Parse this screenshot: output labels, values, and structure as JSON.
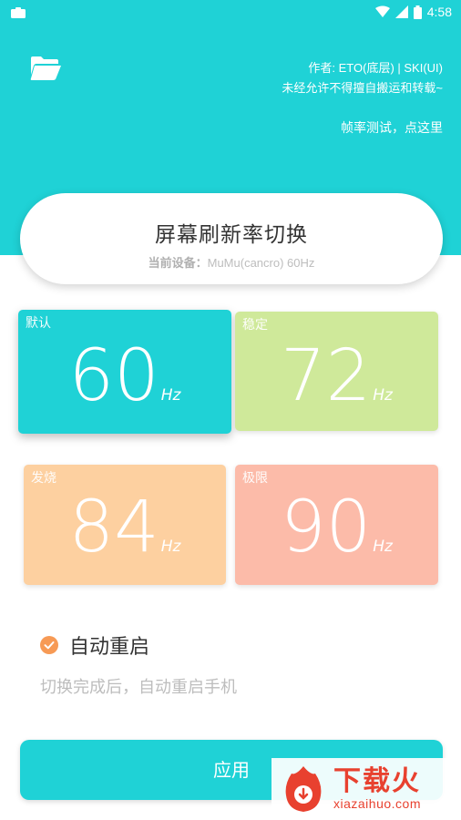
{
  "status_bar": {
    "time": "4:58"
  },
  "header": {
    "author": "作者: ETO(底层) | SKI(UI)",
    "notice": "未经允许不得擅自搬运和转载~",
    "fps_link": "帧率测试，点这里"
  },
  "title_card": {
    "title": "屏幕刷新率切换",
    "device_label": "当前设备：",
    "device_value": "MuMu(cancro) 60Hz"
  },
  "modes": [
    {
      "label": "默认",
      "value": "60",
      "unit": "Hz",
      "color": "#1fd2d6"
    },
    {
      "label": "稳定",
      "value": "72",
      "unit": "Hz",
      "color": "#cfe99a"
    },
    {
      "label": "发烧",
      "value": "84",
      "unit": "Hz",
      "color": "#fdd0a0"
    },
    {
      "label": "极限",
      "value": "90",
      "unit": "Hz",
      "color": "#fcbba9"
    }
  ],
  "auto_restart": {
    "label": "自动重启",
    "checked": true,
    "description": "切换完成后，自动重启手机"
  },
  "apply_button": "应用",
  "watermark": {
    "cn": "下载火",
    "en": "xiazaihuo.com"
  },
  "colors": {
    "primary": "#1fd2d6",
    "check": "#f79a55"
  }
}
